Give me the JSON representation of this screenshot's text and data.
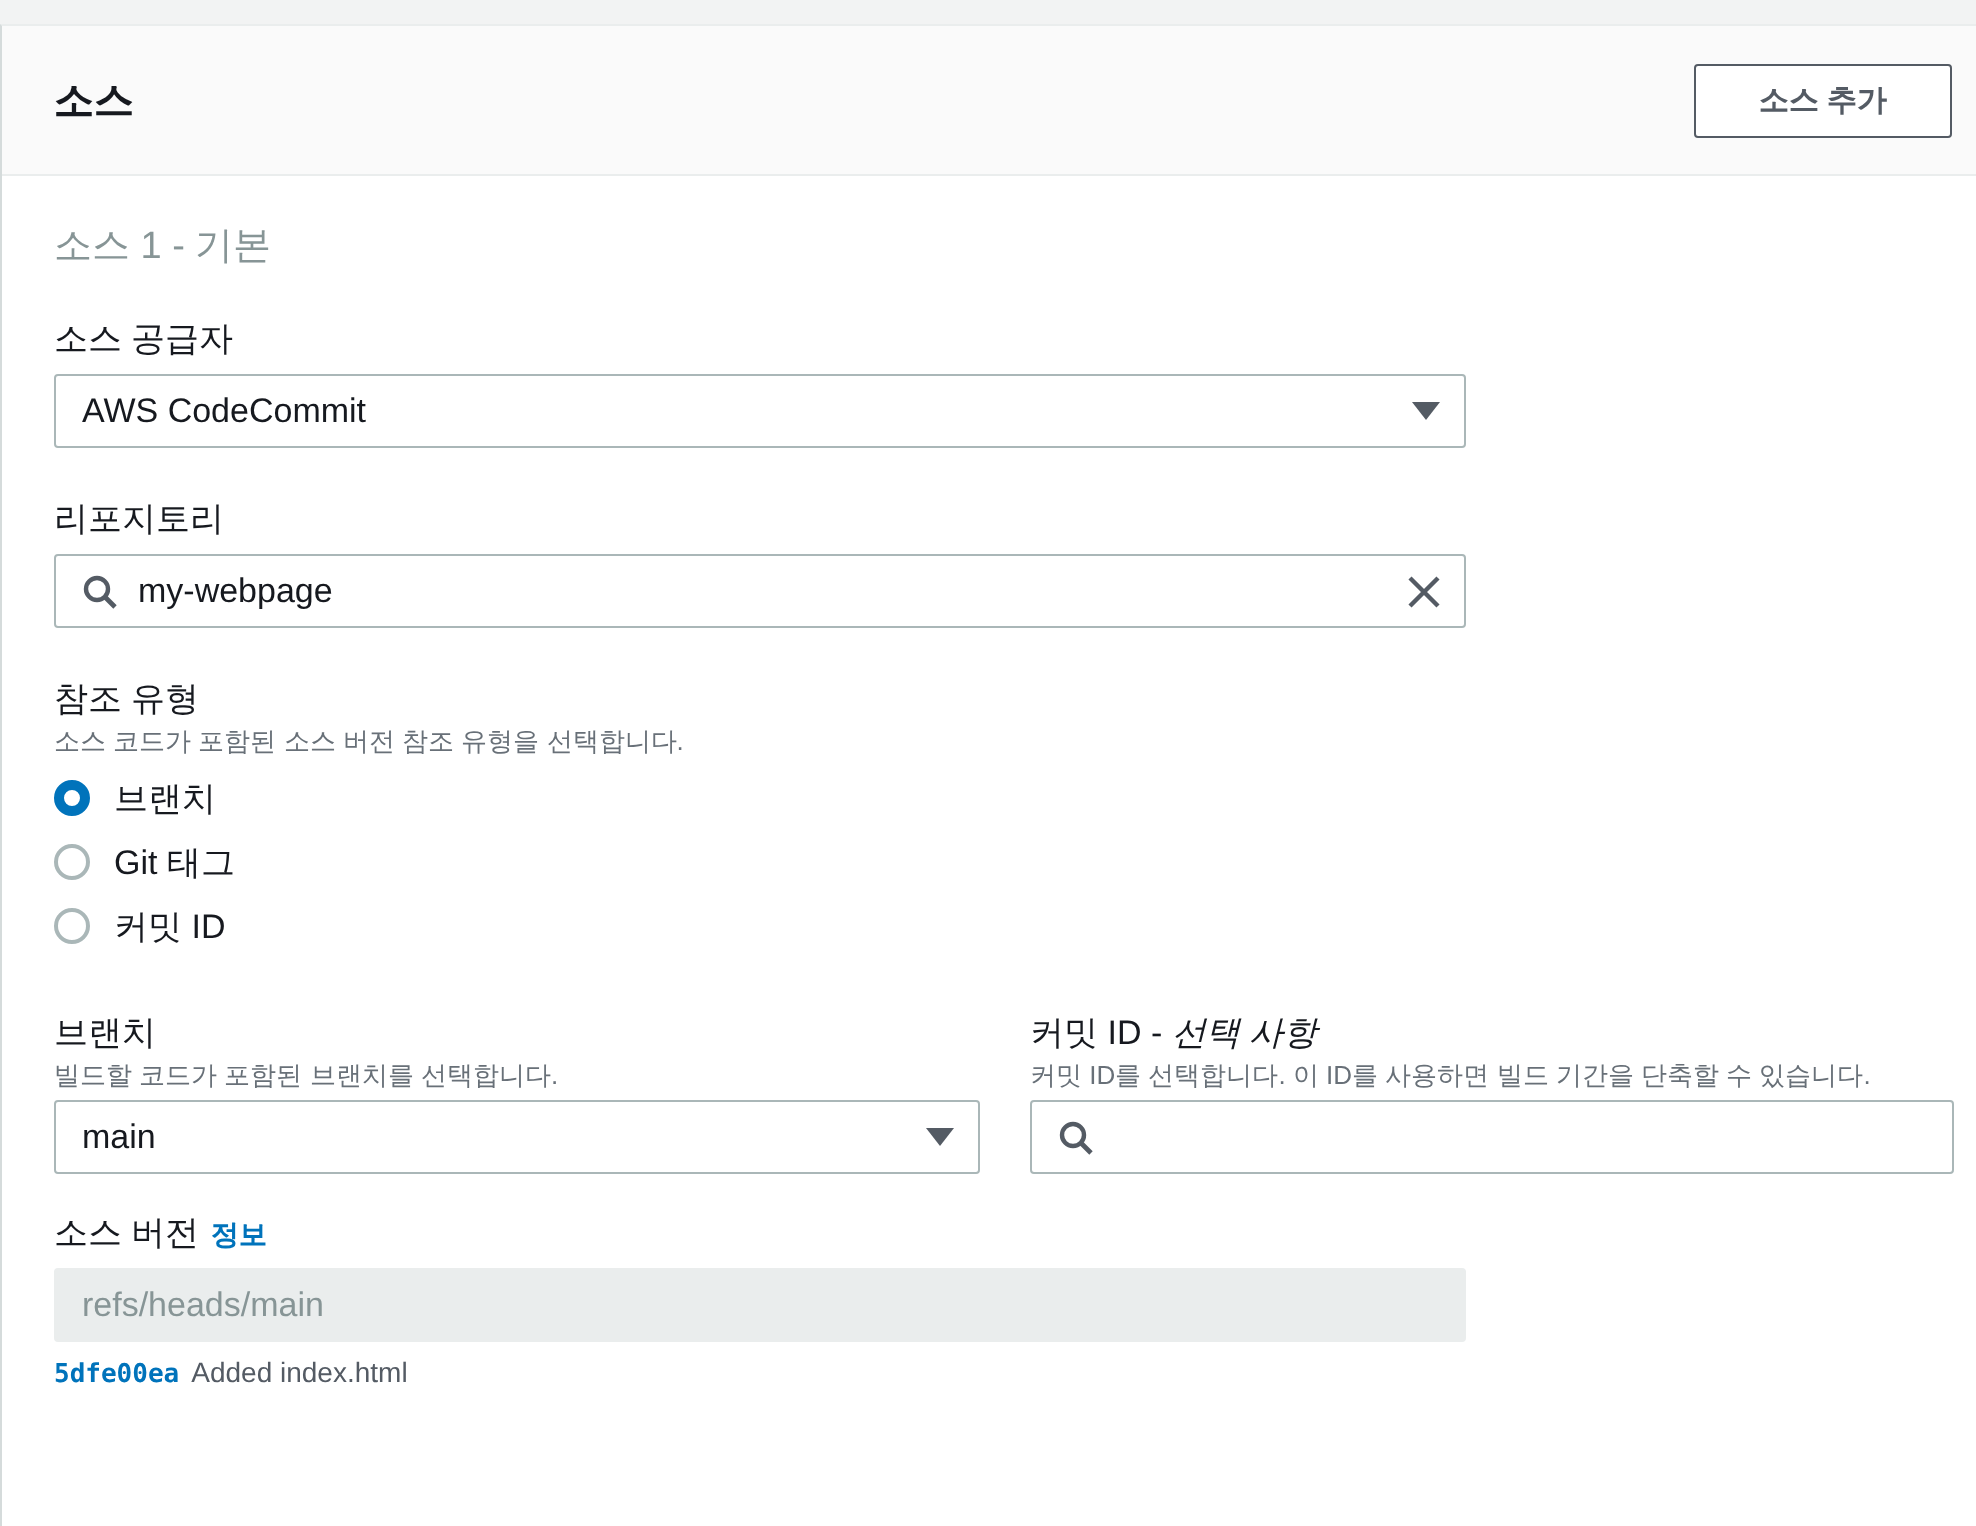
{
  "panel": {
    "title": "소스",
    "add_button": "소스 추가"
  },
  "section_title": "소스 1 - 기본",
  "provider": {
    "label": "소스 공급자",
    "value": "AWS CodeCommit"
  },
  "repository": {
    "label": "리포지토리",
    "value": "my-webpage"
  },
  "reference_type": {
    "label": "참조 유형",
    "description": "소스 코드가 포함된 소스 버전 참조 유형을 선택합니다.",
    "options": [
      {
        "label": "브랜치",
        "selected": true
      },
      {
        "label": "Git 태그",
        "selected": false
      },
      {
        "label": "커밋 ID",
        "selected": false
      }
    ]
  },
  "branch": {
    "label": "브랜치",
    "description": "빌드할 코드가 포함된 브랜치를 선택합니다.",
    "value": "main"
  },
  "commit_id": {
    "label": "커밋 ID - ",
    "label_optional": "선택 사항",
    "description": "커밋 ID를 선택합니다. 이 ID를 사용하면 빌드 기간을 단축할 수 있습니다."
  },
  "source_version": {
    "label": "소스 버전",
    "info_link": "정보",
    "value": "refs/heads/main",
    "commit_hash": "5dfe00ea",
    "commit_message": "Added index.html"
  }
}
